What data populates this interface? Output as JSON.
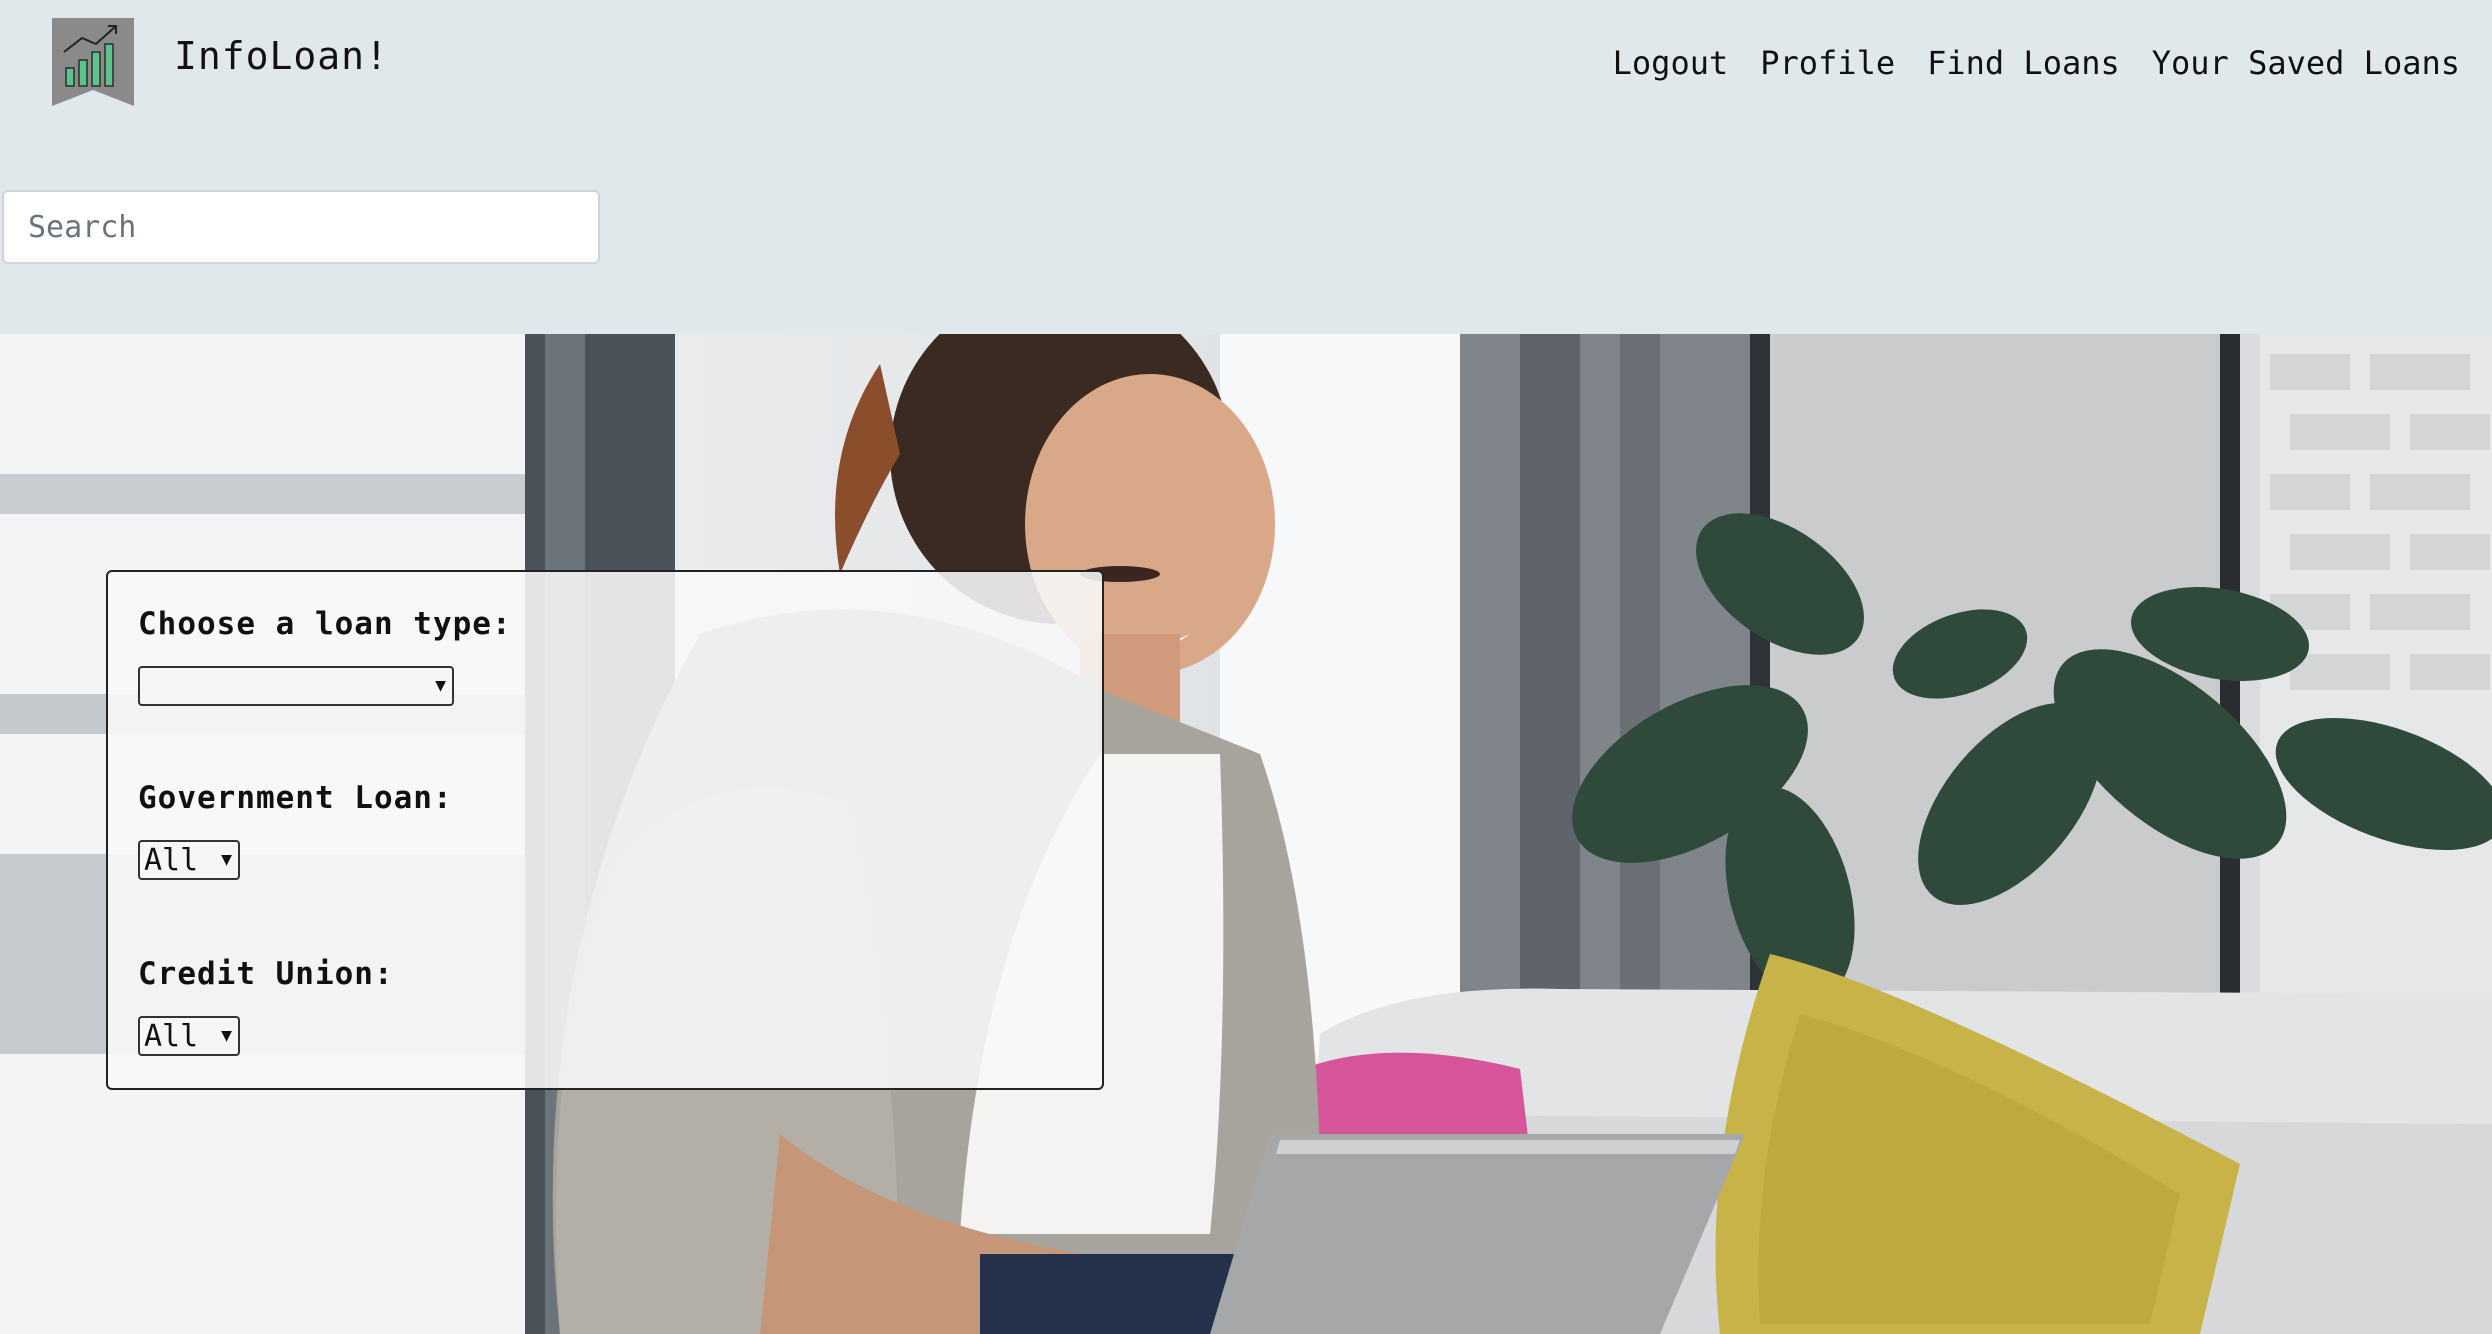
{
  "app": {
    "brand": "InfoLoan!",
    "logo_icon": "chart-growth-icon",
    "colors": {
      "header_bg": "#e1e8ec",
      "logo_bg": "#8a8a8a",
      "logo_bars": "#5cc48a"
    }
  },
  "nav": {
    "items": [
      {
        "label": "Logout"
      },
      {
        "label": "Profile"
      },
      {
        "label": "Find Loans"
      },
      {
        "label": "Your Saved Loans"
      }
    ]
  },
  "search": {
    "placeholder": "Search",
    "value": ""
  },
  "filters": {
    "loan_type": {
      "label": "Choose a loan type:",
      "selected": ""
    },
    "government_loan": {
      "label": "Government Loan:",
      "selected": "All"
    },
    "credit_union": {
      "label": "Credit Union:",
      "selected": "All"
    }
  }
}
